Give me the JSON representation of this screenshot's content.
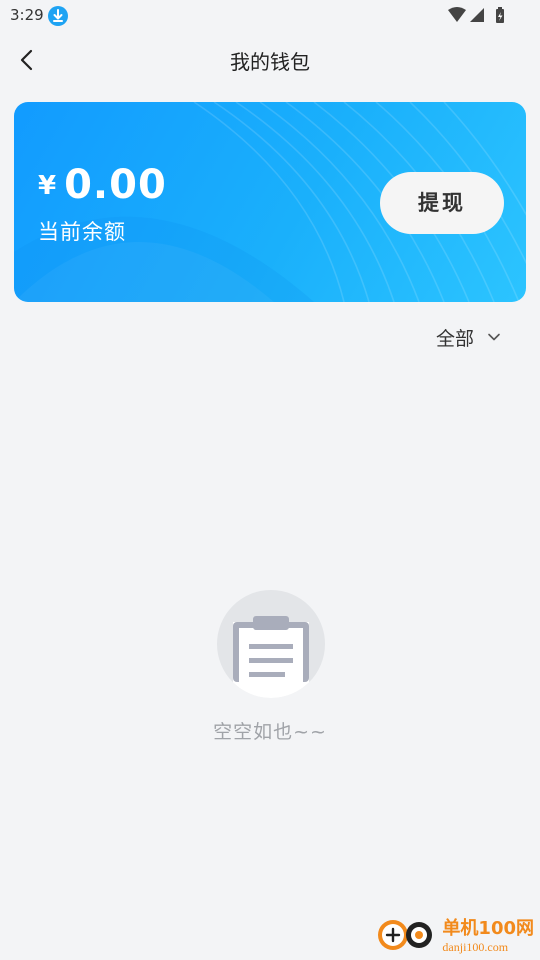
{
  "status_bar": {
    "time": "3:29",
    "icons": [
      "download-icon",
      "wifi-icon",
      "signal-icon",
      "battery-icon"
    ]
  },
  "header": {
    "title": "我的钱包",
    "back_icon": "chevron-left-icon"
  },
  "wallet_card": {
    "currency_symbol": "¥",
    "balance": "0.00",
    "balance_label": "当前余额",
    "withdraw_label": "提现",
    "gradient_colors": [
      "#129bff",
      "#2cc4ff"
    ]
  },
  "filter": {
    "selected": "全部",
    "icon": "chevron-down-icon"
  },
  "empty_state": {
    "icon": "clipboard-icon",
    "message": "空空如也~~"
  },
  "watermark": {
    "name": "单机100网",
    "url": "danji100.com",
    "color": "#f28a1c"
  },
  "colors": {
    "background": "#f3f4f6",
    "accent": "#1ea3f3",
    "empty_text": "#a0a3a8"
  }
}
